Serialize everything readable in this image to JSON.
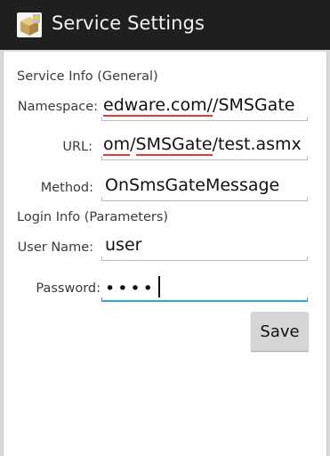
{
  "titlebar": {
    "title": "Service Settings",
    "icon": "box-package-icon"
  },
  "service_info": {
    "heading": "Service Info (General)",
    "namespace": {
      "label": "Namespace:",
      "value_pre": "edware.com/",
      "value_mid": "/SMSGate",
      "value_post": ""
    },
    "url": {
      "label": "URL:",
      "value_a": "om",
      "value_b": "/",
      "value_c": "SMSGate",
      "value_d": "/test.asmx"
    },
    "method": {
      "label": "Method:",
      "value": "OnSmsGateMessage"
    }
  },
  "login_info": {
    "heading": "Login Info (Parameters)",
    "username": {
      "label": "User Name:",
      "value": "user"
    },
    "password": {
      "label": "Password:",
      "value": "••••"
    }
  },
  "actions": {
    "save_label": "Save"
  },
  "colors": {
    "titlebar": "#1f1f1f",
    "focus": "#2ba7d9",
    "spellcheck": "#e23a3a"
  }
}
